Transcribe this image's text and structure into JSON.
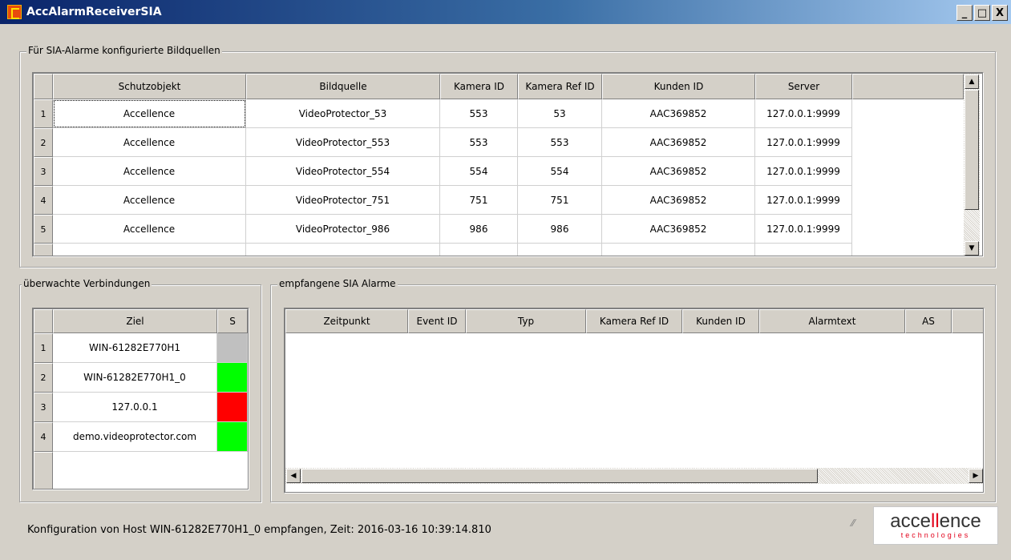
{
  "window": {
    "title": "AccAlarmReceiverSIA",
    "minimize": "_",
    "maximize": "□",
    "close": "X"
  },
  "sources": {
    "title": "Für SIA-Alarme konfigurierte Bildquellen",
    "columns": [
      "Schutzobjekt",
      "Bildquelle",
      "Kamera ID",
      "Kamera Ref ID",
      "Kunden ID",
      "Server"
    ],
    "rows": [
      {
        "n": "1",
        "cells": [
          "Accellence",
          "VideoProtector_53",
          "553",
          "53",
          "AAC369852",
          "127.0.0.1:9999"
        ]
      },
      {
        "n": "2",
        "cells": [
          "Accellence",
          "VideoProtector_553",
          "553",
          "553",
          "AAC369852",
          "127.0.0.1:9999"
        ]
      },
      {
        "n": "3",
        "cells": [
          "Accellence",
          "VideoProtector_554",
          "554",
          "554",
          "AAC369852",
          "127.0.0.1:9999"
        ]
      },
      {
        "n": "4",
        "cells": [
          "Accellence",
          "VideoProtector_751",
          "751",
          "751",
          "AAC369852",
          "127.0.0.1:9999"
        ]
      },
      {
        "n": "5",
        "cells": [
          "Accellence",
          "VideoProtector_986",
          "986",
          "986",
          "AAC369852",
          "127.0.0.1:9999"
        ]
      },
      {
        "n": "",
        "cells": [
          "",
          "",
          "",
          "",
          "",
          ""
        ]
      }
    ]
  },
  "connections": {
    "title": "überwachte Verbindungen",
    "columns": [
      "Ziel",
      "S"
    ],
    "rows": [
      {
        "n": "1",
        "target": "WIN-61282E770H1",
        "status_color": "#c0c0c0"
      },
      {
        "n": "2",
        "target": "WIN-61282E770H1_0",
        "status_color": "#00ff00"
      },
      {
        "n": "3",
        "target": "127.0.0.1",
        "status_color": "#ff0000"
      },
      {
        "n": "4",
        "target": "demo.videoprotector.com",
        "status_color": "#00ff00"
      }
    ]
  },
  "alarms": {
    "title": "empfangene SIA Alarme",
    "columns": [
      "Zeitpunkt",
      "Event ID",
      "Typ",
      "Kamera Ref ID",
      "Kunden ID",
      "Alarmtext",
      "AS"
    ]
  },
  "statusbar": {
    "text": "Konfiguration von Host WIN-61282E770H1_0 empfangen, Zeit: 2016-03-16 10:39:14.810"
  },
  "logo": {
    "main_a": "acce",
    "main_b": "ll",
    "main_c": "ence",
    "sub": "technologies"
  }
}
